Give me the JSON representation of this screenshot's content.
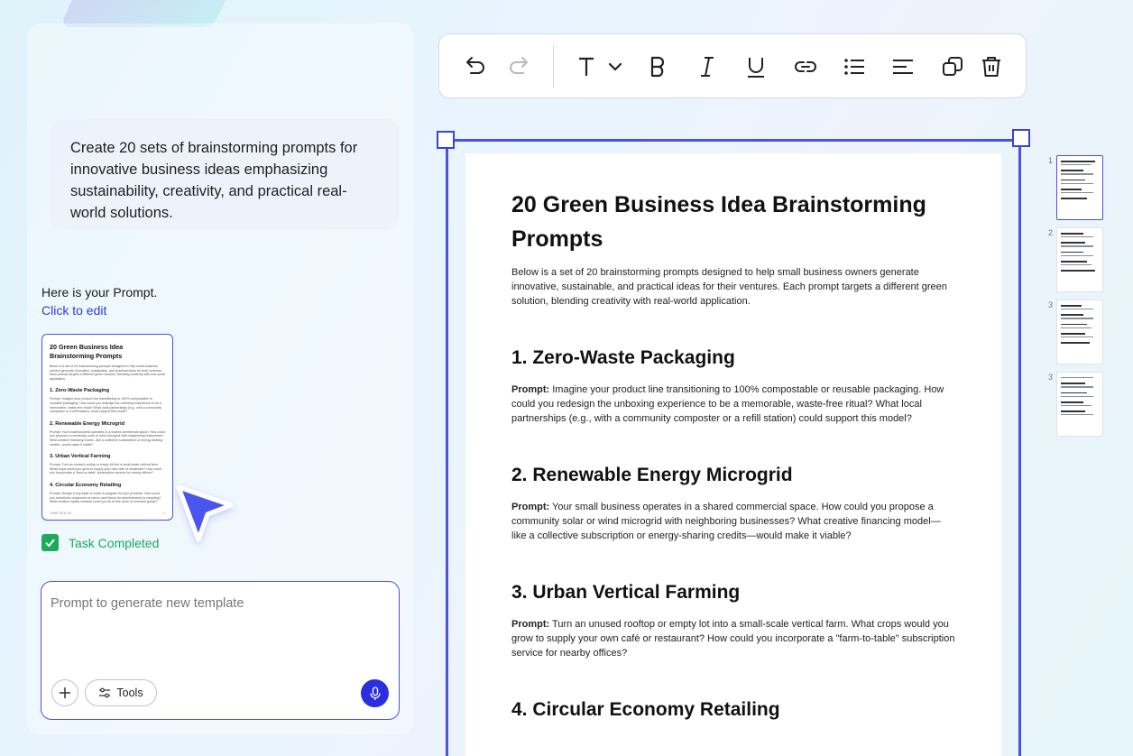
{
  "chat": {
    "user_prompt": "Create 20 sets of brainstorming prompts for innovative business ideas emphasizing sustainability, creativity, and practical real-world solutions.",
    "response_text": "Here is your Prompt.",
    "edit_link": "Click to edit",
    "task_status": "Task Completed"
  },
  "mini_preview": {
    "title": "20 Green Business Idea Brainstorming Prompts",
    "intro": "Below is a set of 20 brainstorming prompts designed to help small business owners generate innovative, sustainable, and practical ideas for their ventures. Each prompt targets a different green solution, blending creativity with real-world application.",
    "sections": [
      {
        "heading": "1. Zero-Waste Packaging",
        "text": "Prompt: Imagine your product line transitioning to 100% compostable or reusable packaging. How could you redesign the unboxing experience to be a memorable, waste-free ritual? What local partnerships (e.g., with a community composter or a refill station) could support this model?"
      },
      {
        "heading": "2. Renewable Energy Microgrid",
        "text": "Prompt: Your small business operates in a shared commercial space. How could you propose a community solar or wind microgrid with neighboring businesses? What creative financing model—like a collective subscription or energy-sharing credits—would make it viable?"
      },
      {
        "heading": "3. Urban Vertical Farming",
        "text": "Prompt: Turn an unused rooftop or empty lot into a small-scale vertical farm. What crops would you grow to supply your own café or restaurant? How could you incorporate a \"farm-to-table\" subscription service for nearby offices?"
      },
      {
        "heading": "4. Circular Economy Retailing",
        "text": "Prompt: Design a buy-back or trade-in program for your products. How could you incentivize customers to return used items for refurbishment or recycling? What creative loyalty rewards could you tie to this circle of renewed goods?"
      }
    ],
    "footer_left": "TEMPLATE 1/3",
    "footer_right": "1"
  },
  "composer": {
    "placeholder": "Prompt to generate new template",
    "tools_label": "Tools"
  },
  "toolbar": {
    "icons": [
      "undo-icon",
      "redo-icon",
      "text-style-icon",
      "bold-icon",
      "italic-icon",
      "underline-icon",
      "link-icon",
      "bullet-list-icon",
      "align-left-icon",
      "duplicate-icon",
      "delete-icon"
    ]
  },
  "document": {
    "title": "20 Green Business Idea Brainstorming Prompts",
    "intro": "Below is a set of 20 brainstorming prompts designed to help small business owners generate innovative, sustainable, and practical ideas for their ventures. Each prompt targets a different green solution, blending creativity with real-world application.",
    "prompt_label": "Prompt:",
    "sections": [
      {
        "heading": "1. Zero-Waste Packaging",
        "text": "Imagine your product line transitioning to 100% compostable or reusable packaging. How could you redesign the unboxing experience to be a memorable, waste-free ritual? What local partnerships (e.g., with a community composter or a refill station) could support this model?"
      },
      {
        "heading": "2. Renewable Energy Microgrid",
        "text": "Your small business operates in a shared commercial space. How could you propose a community solar or wind microgrid with neighboring businesses? What creative financing model—like a collective subscription or energy-sharing credits—would make it viable?"
      },
      {
        "heading": "3. Urban Vertical Farming",
        "text": "Turn an unused rooftop or empty lot into a small-scale vertical farm. What crops would you grow to supply your own café or restaurant? How could you incorporate a \"farm-to-table\" subscription service for nearby offices?"
      },
      {
        "heading": "4. Circular Economy Retailing",
        "text": ""
      }
    ]
  },
  "thumbnails": {
    "pages": [
      {
        "number": "1",
        "active": true
      },
      {
        "number": "2",
        "active": false
      },
      {
        "number": "3",
        "active": false
      },
      {
        "number": "3",
        "active": false
      }
    ]
  },
  "colors": {
    "accent": "#4a52e0",
    "success": "#1faa59",
    "mic": "#2b2ee0"
  }
}
